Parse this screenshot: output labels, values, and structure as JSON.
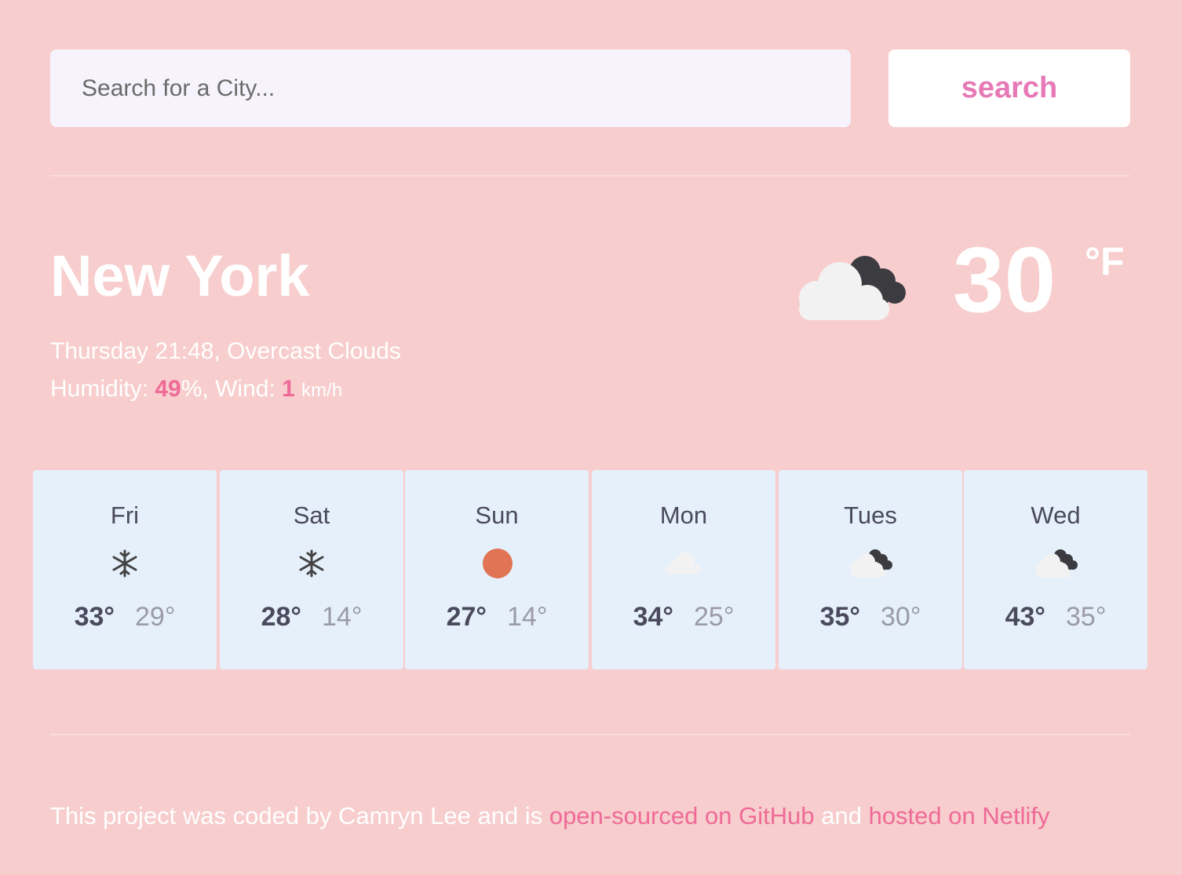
{
  "search": {
    "placeholder": "Search for a City...",
    "value": "",
    "button_label": "search"
  },
  "current": {
    "city": "New York",
    "day_time": "Thursday 21:48,",
    "description": "Overcast Clouds",
    "humidity_label": "Humidity:",
    "humidity_value": "49",
    "humidity_unit": "%,",
    "wind_label": "Wind:",
    "wind_value": "1",
    "wind_unit": "km/h",
    "temperature": "30",
    "temp_unit": "°F",
    "icon": "broken-clouds-icon"
  },
  "forecast": [
    {
      "day": "Fri",
      "icon": "snow-icon",
      "max": "33°",
      "min": "29°"
    },
    {
      "day": "Sat",
      "icon": "snow-icon",
      "max": "28°",
      "min": "14°"
    },
    {
      "day": "Sun",
      "icon": "sun-icon",
      "max": "27°",
      "min": "14°"
    },
    {
      "day": "Mon",
      "icon": "cloud-icon",
      "max": "34°",
      "min": "25°"
    },
    {
      "day": "Tues",
      "icon": "broken-clouds-icon",
      "max": "35°",
      "min": "30°"
    },
    {
      "day": "Wed",
      "icon": "broken-clouds-icon",
      "max": "43°",
      "min": "35°"
    }
  ],
  "footer": {
    "prefix": "This project was coded by Camryn Lee and is",
    "github_link": "open-sourced on GitHub",
    "middle": "and",
    "netlify_link": "hosted on Netlify"
  },
  "colors": {
    "background": "#f7cdcd",
    "accent": "#ef6a97",
    "button_text": "#e679b6",
    "card": "#e6f0fb"
  }
}
